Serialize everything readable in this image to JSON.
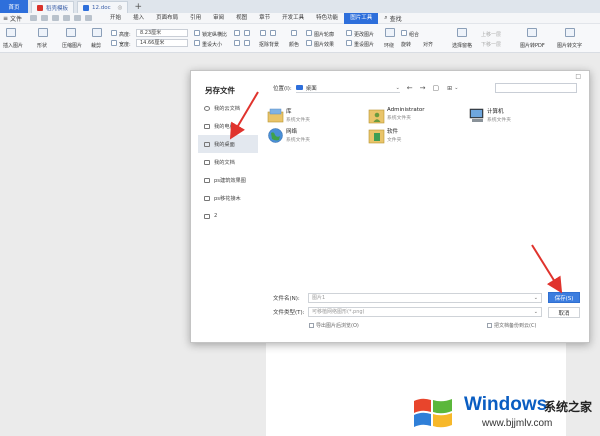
{
  "titlebar": {
    "home_tab": "首页",
    "tabs": [
      {
        "label": "稻壳模板",
        "icon": "daoke-icon",
        "color": "#d9322b"
      },
      {
        "label": "12.doc",
        "icon": "word-doc-icon",
        "color": "#2e6fdb"
      }
    ],
    "new_tab": "+"
  },
  "menubar": {
    "file_label": "文件",
    "items": [
      "开始",
      "插入",
      "页面布局",
      "引用",
      "审阅",
      "视图",
      "章节",
      "开发工具",
      "特色功能",
      "图片工具"
    ],
    "active_index": 9,
    "search_label": "查找"
  },
  "ribbon": {
    "insert_image": "插入图片",
    "shape": "形状",
    "compress": "压缩图片",
    "crop": "裁剪",
    "height_label": "高度:",
    "height_value": "8.23厘米",
    "width_label": "宽度:",
    "width_value": "14.66厘米",
    "lock_ratio": "锁定纵横比",
    "reset_size": "重设大小",
    "remove_bg": "抠除背景",
    "color": "颜色",
    "image_outline": "图片轮廓",
    "image_effects": "图片效果",
    "change_image": "更改图片",
    "reset_image": "重设图片",
    "wrap": "环绕",
    "combine": "组合",
    "rotate": "旋转",
    "align": "对齐",
    "selection_pane": "选择窗格",
    "bring_forward": "上移一层",
    "send_backward": "下移一层",
    "to_pdf": "图片转PDF",
    "to_text": "图片转文字"
  },
  "dialog": {
    "title": "另存文件",
    "close": "□",
    "sidebar": [
      {
        "label": "我的云文档",
        "icon": "cloud-doc-icon"
      },
      {
        "label": "我的电脑",
        "icon": "computer-icon"
      },
      {
        "label": "我的桌面",
        "icon": "desktop-icon",
        "selected": true
      },
      {
        "label": "我的文档",
        "icon": "documents-icon"
      },
      {
        "label": "ps建筑效果图",
        "icon": "folder-icon"
      },
      {
        "label": "ps移花接木",
        "icon": "folder-icon"
      },
      {
        "label": "2",
        "icon": "folder-icon"
      }
    ],
    "location_label": "位置(I):",
    "location_value": "桌面",
    "files": [
      {
        "name": "库",
        "type": "系统文件夹",
        "icon": "library-icon"
      },
      {
        "name": "Administrator",
        "type": "系统文件夹",
        "icon": "user-folder-icon"
      },
      {
        "name": "计算机",
        "type": "系统文件夹",
        "icon": "computer-icon"
      },
      {
        "name": "网络",
        "type": "系统文件夹",
        "icon": "network-icon"
      },
      {
        "name": "软件",
        "type": "文件夹",
        "icon": "software-folder-icon"
      }
    ],
    "filename_label": "文件名(N):",
    "filename_value": "图片1",
    "filetype_label": "文件类型(T):",
    "filetype_value": "可移植网络图形(*.png)",
    "export_checkbox": "导出图片后浏览(O)",
    "backup_checkbox": "把文档备份到云(C)",
    "save_button": "保存(S)",
    "cancel_button": "取消"
  },
  "watermark": {
    "brand": "Windows",
    "zh": "系统之家",
    "url": "www.bjjmlv.com"
  },
  "colors": {
    "accent": "#2e6fdb",
    "annotation_arrow": "#e0332d",
    "primary_button": "#3c7ddf"
  }
}
